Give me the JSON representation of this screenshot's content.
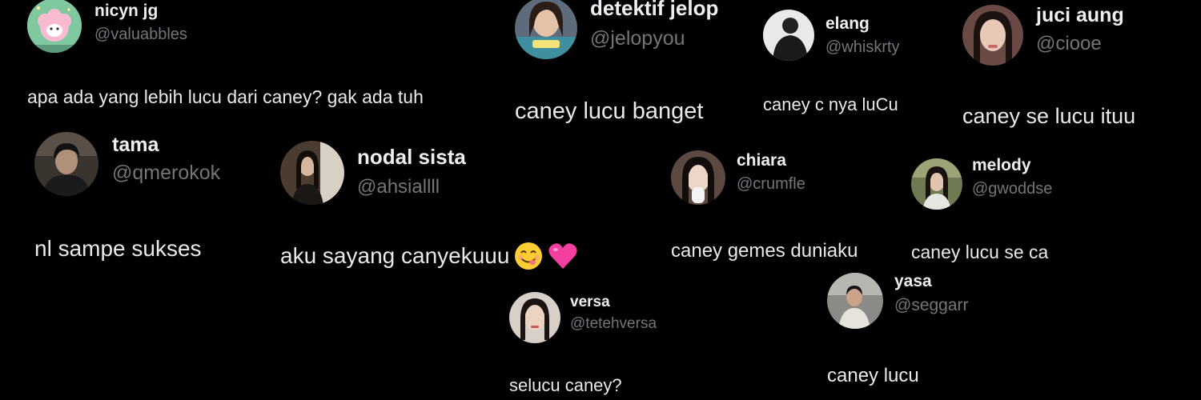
{
  "posts": [
    {
      "name": "nicyn jg",
      "handle": "@valuabbles",
      "text": "apa ada yang lebih lucu dari caney? gak ada tuh",
      "avatar_icon": "pink-sheep-avatar",
      "avatar_color": "#9fd3a8"
    },
    {
      "name": "detektif jelop",
      "handle": "@jelopyou",
      "text": "caney lucu banget",
      "avatar_icon": "girl-photo-avatar",
      "avatar_color": "#5d6b7a"
    },
    {
      "name": "elang",
      "handle": "@whiskrty",
      "text": "caney c nya luCu",
      "avatar_icon": "person-dark-avatar",
      "avatar_color": "#2b2b2b"
    },
    {
      "name": "juci aung",
      "handle": "@ciooe",
      "text": "caney se lucu ituu",
      "avatar_icon": "girl-photo-avatar",
      "avatar_color": "#6b4a46"
    },
    {
      "name": "tama",
      "handle": "@qmerokok",
      "text": "nl sampe sukses",
      "avatar_icon": "person-dark-avatar",
      "avatar_color": "#3a342e"
    },
    {
      "name": "nodal sista",
      "handle": "@ahsiallll",
      "text": "aku sayang canyekuuu",
      "avatar_icon": "girl-photo-avatar",
      "avatar_color": "#4a3c30"
    },
    {
      "name": "chiara",
      "handle": "@crumfle",
      "text": "caney gemes duniaku",
      "avatar_icon": "girl-photo-avatar",
      "avatar_color": "#5c4a42"
    },
    {
      "name": "melody",
      "handle": "@gwoddse",
      "text": "caney lucu se ca",
      "avatar_icon": "girl-photo-avatar",
      "avatar_color": "#6f7a52"
    },
    {
      "name": "versa",
      "handle": "@tetehversa",
      "text": "selucu caney?",
      "avatar_icon": "girl-photo-avatar",
      "avatar_color": "#8a7a70"
    },
    {
      "name": "yasa",
      "handle": "@seggarr",
      "text": "caney lucu",
      "avatar_icon": "boy-photo-avatar",
      "avatar_color": "#8b8a86"
    }
  ],
  "emojis": [
    "yum-face-emoji",
    "pink-heart-emoji"
  ],
  "colors": {
    "background": "#000000",
    "name": "#eceff1",
    "handle": "#71767b",
    "text": "#e7e9ea"
  }
}
